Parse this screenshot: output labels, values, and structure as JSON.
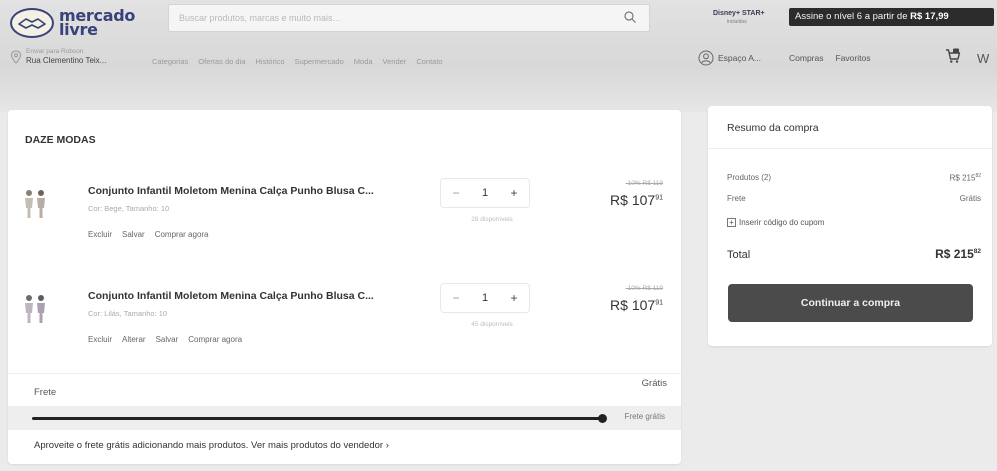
{
  "header": {
    "logo_text": "mercado\nlivre",
    "search_placeholder": "Buscar produtos, marcas e muito mais…",
    "disney_text": "Disney+ STAR+",
    "disney_sub": "incluídos",
    "promo_text": "Assine o nível 6 a partir de ",
    "promo_price": "R$ 17,99",
    "location_small": "Enviar para Robson",
    "location_address": "Rua Clementino Teix...",
    "nav_items": [
      "Categorias",
      "Ofertas do dia",
      "Histórico",
      "Supermercado",
      "Moda",
      "Vender",
      "Contato"
    ],
    "account_label": "Espaço A...",
    "purchases_label": "Compras",
    "favorites_label": "Favoritos",
    "right_cut": "W"
  },
  "cart": {
    "seller": "DAZE MODAS",
    "items": [
      {
        "title": "Conjunto Infantil Moletom Menina Calça Punho Blusa C...",
        "variant": "Cor: Bege, Tamanho: 10",
        "actions": [
          "Excluir",
          "Salvar",
          "Comprar agora"
        ],
        "quantity": "1",
        "stock": "28 disponíveis",
        "old_price": "-10% R$ 119",
        "price": "R$ 107",
        "price_cents": "91"
      },
      {
        "title": "Conjunto Infantil Moletom Menina Calça Punho Blusa C...",
        "variant": "Cor: Lilás, Tamanho: 10",
        "actions": [
          "Excluir",
          "Alterar",
          "Salvar",
          "Comprar agora"
        ],
        "quantity": "1",
        "stock": "45 disponíveis",
        "old_price": "-10% R$ 119",
        "price": "R$ 107",
        "price_cents": "91"
      }
    ],
    "shipping_label": "Frete",
    "shipping_value": "Grátis",
    "progress_label": "Frete grátis",
    "progress_fraction": 1.0,
    "free_shipping_message": "Aproveite o frete grátis adicionando mais produtos.",
    "more_products_link": "Ver mais produtos do vendedor ›"
  },
  "summary": {
    "title": "Resumo da compra",
    "products_label": "Produtos (2)",
    "products_value": "R$ 215",
    "products_cents": "82",
    "shipping_label": "Frete",
    "shipping_value": "Grátis",
    "coupon_label": "Inserir código do cupom",
    "total_label": "Total",
    "total_value": "R$ 215",
    "total_cents": "82",
    "continue_label": "Continuar a compra"
  },
  "colors": {
    "primary_button": "#4b4b4b",
    "promo_background": "#2c2c2c",
    "logo_blue": "#39427a"
  }
}
